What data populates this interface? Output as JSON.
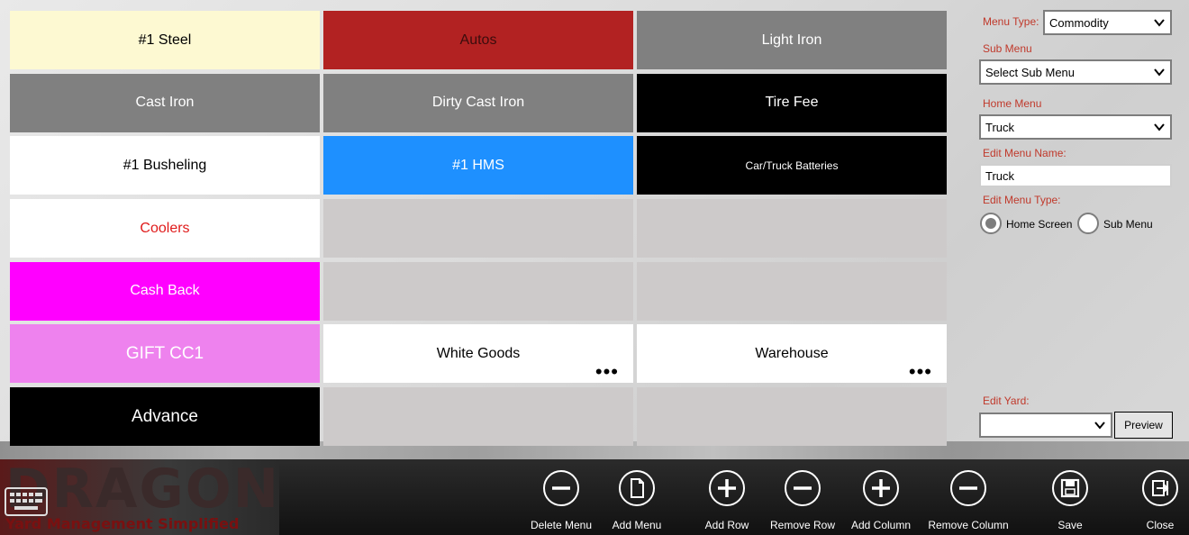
{
  "tiles": [
    {
      "label": "#1 Steel",
      "bg": "#fdf9d2",
      "fg": "#000000",
      "more": false
    },
    {
      "label": "Autos",
      "bg": "#b22222",
      "fg": "#3b0d0d",
      "more": false
    },
    {
      "label": "Light Iron",
      "bg": "#808080",
      "fg": "#ffffff",
      "more": false
    },
    {
      "label": "Cast Iron",
      "bg": "#808080",
      "fg": "#ffffff",
      "more": false
    },
    {
      "label": "Dirty Cast Iron",
      "bg": "#808080",
      "fg": "#ffffff",
      "more": false
    },
    {
      "label": "Tire Fee",
      "bg": "#000000",
      "fg": "#ffffff",
      "more": false
    },
    {
      "label": "#1 Busheling",
      "bg": "#ffffff",
      "fg": "#000000",
      "more": false
    },
    {
      "label": "#1 HMS",
      "bg": "#1e90ff",
      "fg": "#ffffff",
      "more": false
    },
    {
      "label": "Car/Truck Batteries",
      "bg": "#000000",
      "fg": "#ffffff",
      "more": false,
      "small": true
    },
    {
      "label": "Coolers",
      "bg": "#ffffff",
      "fg": "#e01b1b",
      "more": false
    },
    {
      "label": "",
      "bg": "#cdcaca",
      "fg": "#000000",
      "more": false
    },
    {
      "label": "",
      "bg": "#cdcaca",
      "fg": "#000000",
      "more": false
    },
    {
      "label": "Cash Back",
      "bg": "#ff00ff",
      "fg": "#ffffff",
      "more": false
    },
    {
      "label": "",
      "bg": "#cdcaca",
      "fg": "#000000",
      "more": false
    },
    {
      "label": "",
      "bg": "#cdcaca",
      "fg": "#000000",
      "more": false
    },
    {
      "label": "GIFT CC1",
      "bg": "#ee82ee",
      "fg": "#ffffff",
      "more": false,
      "large": true
    },
    {
      "label": "White Goods",
      "bg": "#ffffff",
      "fg": "#000000",
      "more": true
    },
    {
      "label": "Warehouse",
      "bg": "#ffffff",
      "fg": "#000000",
      "more": true
    },
    {
      "label": "Advance",
      "bg": "#000000",
      "fg": "#ffffff",
      "more": false,
      "large": true
    },
    {
      "label": "",
      "bg": "#cdcaca",
      "fg": "#000000",
      "more": false
    },
    {
      "label": "",
      "bg": "#cdcaca",
      "fg": "#000000",
      "more": false
    }
  ],
  "more_glyph": "•••",
  "panel": {
    "menu_type_label": "Menu Type:",
    "menu_type_value": "Commodity",
    "sub_menu_label": "Sub Menu",
    "sub_menu_value": "Select Sub Menu",
    "home_menu_label": "Home Menu",
    "home_menu_value": "Truck",
    "edit_menu_name_label": "Edit Menu Name:",
    "edit_menu_name_value": "Truck",
    "edit_menu_type_label": "Edit Menu Type:",
    "radio_home": "Home Screen",
    "radio_sub": "Sub Menu",
    "selected_radio": "Home Screen",
    "edit_yard_label": "Edit Yard:",
    "edit_yard_value": "",
    "preview_label": "Preview"
  },
  "logo": {
    "title": "DRAGON",
    "tagline": "Yard Management Simplified"
  },
  "appbar": [
    {
      "label": "Delete Menu",
      "icon": "minus-icon"
    },
    {
      "label": "Add Menu",
      "icon": "page-icon"
    },
    {
      "label": "Add Row",
      "icon": "plus-icon"
    },
    {
      "label": "Remove Row",
      "icon": "minus-icon"
    },
    {
      "label": "Add Column",
      "icon": "plus-icon"
    },
    {
      "label": "Remove Column",
      "icon": "minus-icon"
    },
    {
      "label": "Save",
      "icon": "save-icon"
    },
    {
      "label": "Close",
      "icon": "exit-icon"
    }
  ],
  "colors": {
    "accent_label": "#c0392b",
    "appbar": "#1a1a1a"
  }
}
